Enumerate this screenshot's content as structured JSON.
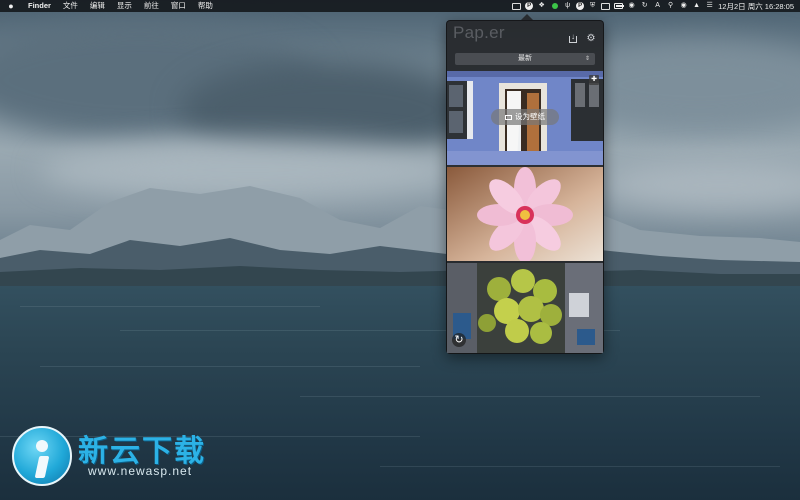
{
  "menubar": {
    "apple": "",
    "items": [
      "Finder",
      "文件",
      "编辑",
      "显示",
      "前往",
      "窗口",
      "帮助"
    ],
    "status_icons": [
      "screen-share-icon",
      "paper-p-icon",
      "dropbox-icon",
      "green-dot-icon",
      "usb-icon",
      "paper-app-icon",
      "shield-icon",
      "cast-icon",
      "battery-icon",
      "record-icon",
      "rotate-icon",
      "input-source-icon",
      "search-icon",
      "siri-icon",
      "user-icon",
      "notification-icon"
    ],
    "input_source_label": "A",
    "clock": "12月2日 周六  16:28:05"
  },
  "panel": {
    "title": "Pap.er",
    "sort_value": "最新",
    "set_wallpaper_label": "设为壁纸",
    "thumbnails": [
      "blue-house-door",
      "pink-cosmos-flower",
      "aerial-city-trees"
    ]
  },
  "watermark": {
    "title": "新云下载",
    "url": "www.newasp.net"
  },
  "colors": {
    "menubar_bg": "#16191d",
    "panel_bg": "#26282c",
    "watermark_blue": "#2cb2e6"
  }
}
